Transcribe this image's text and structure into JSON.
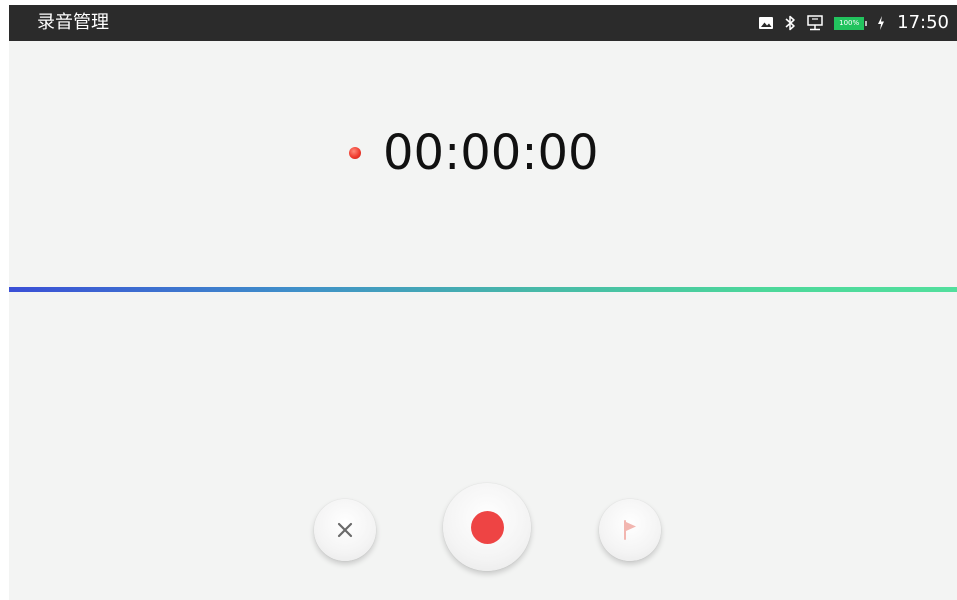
{
  "statusbar": {
    "app_title": "录音管理",
    "battery_level": "100%",
    "time": "17:50",
    "icons": [
      "image-icon",
      "bluetooth-icon",
      "network-icon",
      "battery-icon",
      "charging-icon"
    ]
  },
  "recorder": {
    "timer": "00:00:00",
    "state": "ready",
    "accent_color": "#ee4444"
  },
  "controls": {
    "cancel_icon": "close-icon",
    "record_icon": "record-icon",
    "mark_icon": "flag-icon"
  },
  "waveform": {
    "gradient_start": "#3a4fd6",
    "gradient_end": "#52df9d"
  }
}
